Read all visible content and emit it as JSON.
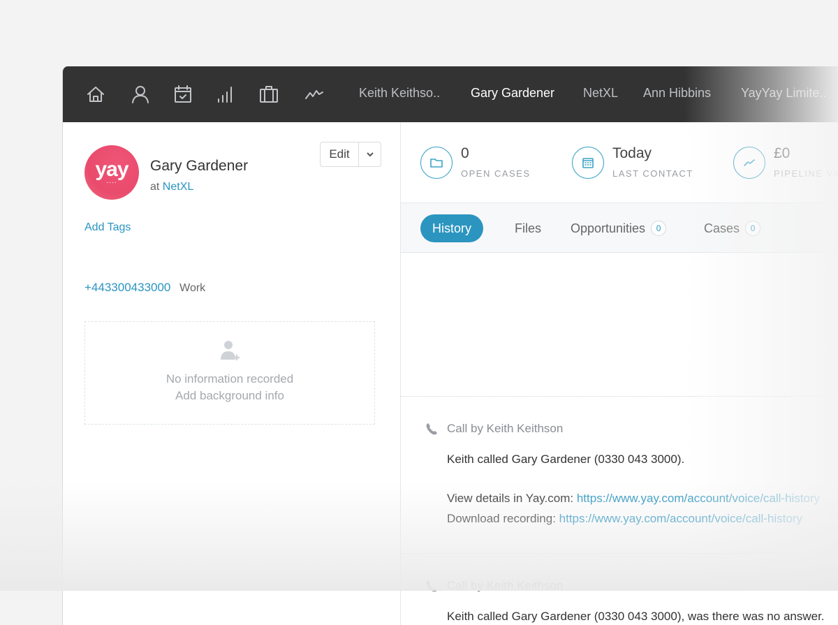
{
  "topbar": {
    "nav_icons": [
      {
        "name": "home-icon",
        "label": "Home"
      },
      {
        "name": "person-icon",
        "label": "People"
      },
      {
        "name": "calendar-icon",
        "label": "Calendar"
      },
      {
        "name": "signal-bars-icon",
        "label": "Reports"
      },
      {
        "name": "briefcase-icon",
        "label": "Cases"
      },
      {
        "name": "activity-icon",
        "label": "Activity"
      }
    ],
    "recent_items": [
      {
        "label": "Keith Keithso..",
        "active": false
      },
      {
        "label": "Gary Gardener",
        "active": true
      },
      {
        "label": "NetXL",
        "active": false
      },
      {
        "label": "Ann Hibbins",
        "active": false
      },
      {
        "label": "YayYay Limite..",
        "active": false
      }
    ]
  },
  "contact": {
    "avatar_text": "yay",
    "avatar_dots": "....",
    "name": "Gary Gardener",
    "org_prefix": "at",
    "org_name": "NetXL",
    "edit_label": "Edit",
    "add_tags_label": "Add Tags",
    "phone_number": "+443300433000",
    "phone_type": "Work",
    "background": {
      "line1": "No information recorded",
      "line2": "Add background info"
    }
  },
  "stats": [
    {
      "value": "0",
      "label": "OPEN CASES",
      "icon": "folder-icon"
    },
    {
      "value": "Today",
      "label": "LAST CONTACT",
      "icon": "calendar-grid-icon"
    },
    {
      "value": "£0",
      "label": "PIPELINE VALUE",
      "icon": "trend-line-icon"
    }
  ],
  "tabs": [
    {
      "label": "History",
      "active": true,
      "count": null
    },
    {
      "label": "Files",
      "active": false,
      "count": null
    },
    {
      "label": "Opportunities",
      "active": false,
      "count": "0"
    },
    {
      "label": "Cases",
      "active": false,
      "count": "0"
    }
  ],
  "history": [
    {
      "title": "Call by Keith Keithson",
      "summary": "Keith called Gary Gardener (0330 043 3000).",
      "details_label": "View details in Yay.com:",
      "details_url": "https://www.yay.com/account/voice/call-history",
      "recording_label": "Download recording:",
      "recording_url": "https://www.yay.com/account/voice/call-history"
    },
    {
      "title": "Call by Keith Keithson",
      "summary": "Keith called Gary Gardener (0330 043 3000), was there was no answer."
    }
  ],
  "colors": {
    "topbar_bg": "#333333",
    "accent": "#2b95c0",
    "avatar": "#e94b6c"
  }
}
